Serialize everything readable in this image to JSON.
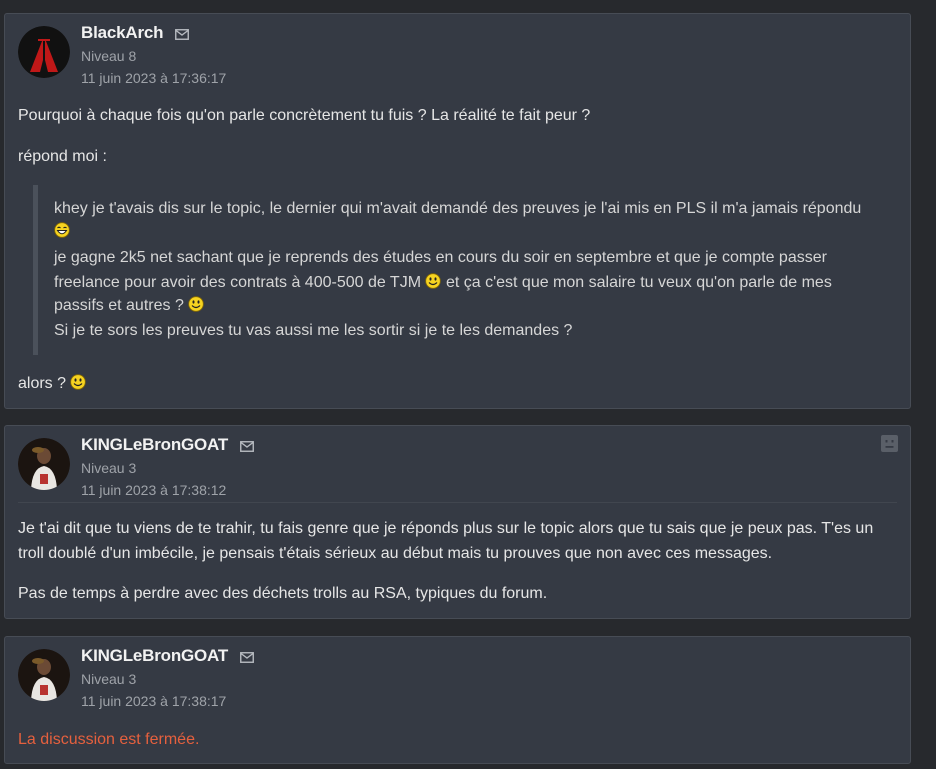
{
  "posts": [
    {
      "author": "BlackArch",
      "level": "Niveau 8",
      "date": "11 juin 2023 à 17:36:17",
      "paragraphs": [
        "Pourquoi à chaque fois qu'on parle concrètement tu fuis ? La réalité te fait peur ?",
        "répond moi :"
      ],
      "quote": {
        "line1": "khey je t'avais dis sur le topic, le dernier qui m'avait demandé des preuves je l'ai mis en PLS il m'a jamais répondu",
        "line3": "je gagne 2k5 net sachant que je reprends des études en cours du soir en septembre et que je compte passer",
        "line4a": "freelance pour avoir des contrats à 400-500 de TJM",
        "line4b": "et ça c'est que mon salaire tu veux qu'on parle de mes",
        "line5": "passifs et autres ?",
        "line6": "Si je te sors les preuves tu vas aussi me les sortir si je te les demandes ?"
      },
      "closing": "alors ?"
    },
    {
      "author": "KINGLeBronGOAT",
      "level": "Niveau 3",
      "date": "11 juin 2023 à 17:38:12",
      "paragraphs": [
        "Je t'ai dit que tu viens de te trahir, tu fais genre que je réponds plus sur le topic alors que tu sais que je peux pas. T'es un",
        "troll doublé d'un imbécile, je pensais t'étais sérieux au début mais tu prouves que non avec ces messages.",
        "Pas de temps à perdre avec des déchets trolls au RSA, typiques du forum."
      ]
    },
    {
      "author": "KINGLeBronGOAT",
      "level": "Niveau 3",
      "date": "11 juin 2023 à 17:38:17",
      "closed_notice": "La discussion est fermée."
    }
  ],
  "icons": {
    "mail": "envelope-icon",
    "report": "report-icon",
    "smiley": "smiley-icon",
    "laugh": "laughing-smiley-icon"
  },
  "colors": {
    "background": "#27292d",
    "post_bg": "#353a44",
    "closed_notice": "#e5603e"
  }
}
